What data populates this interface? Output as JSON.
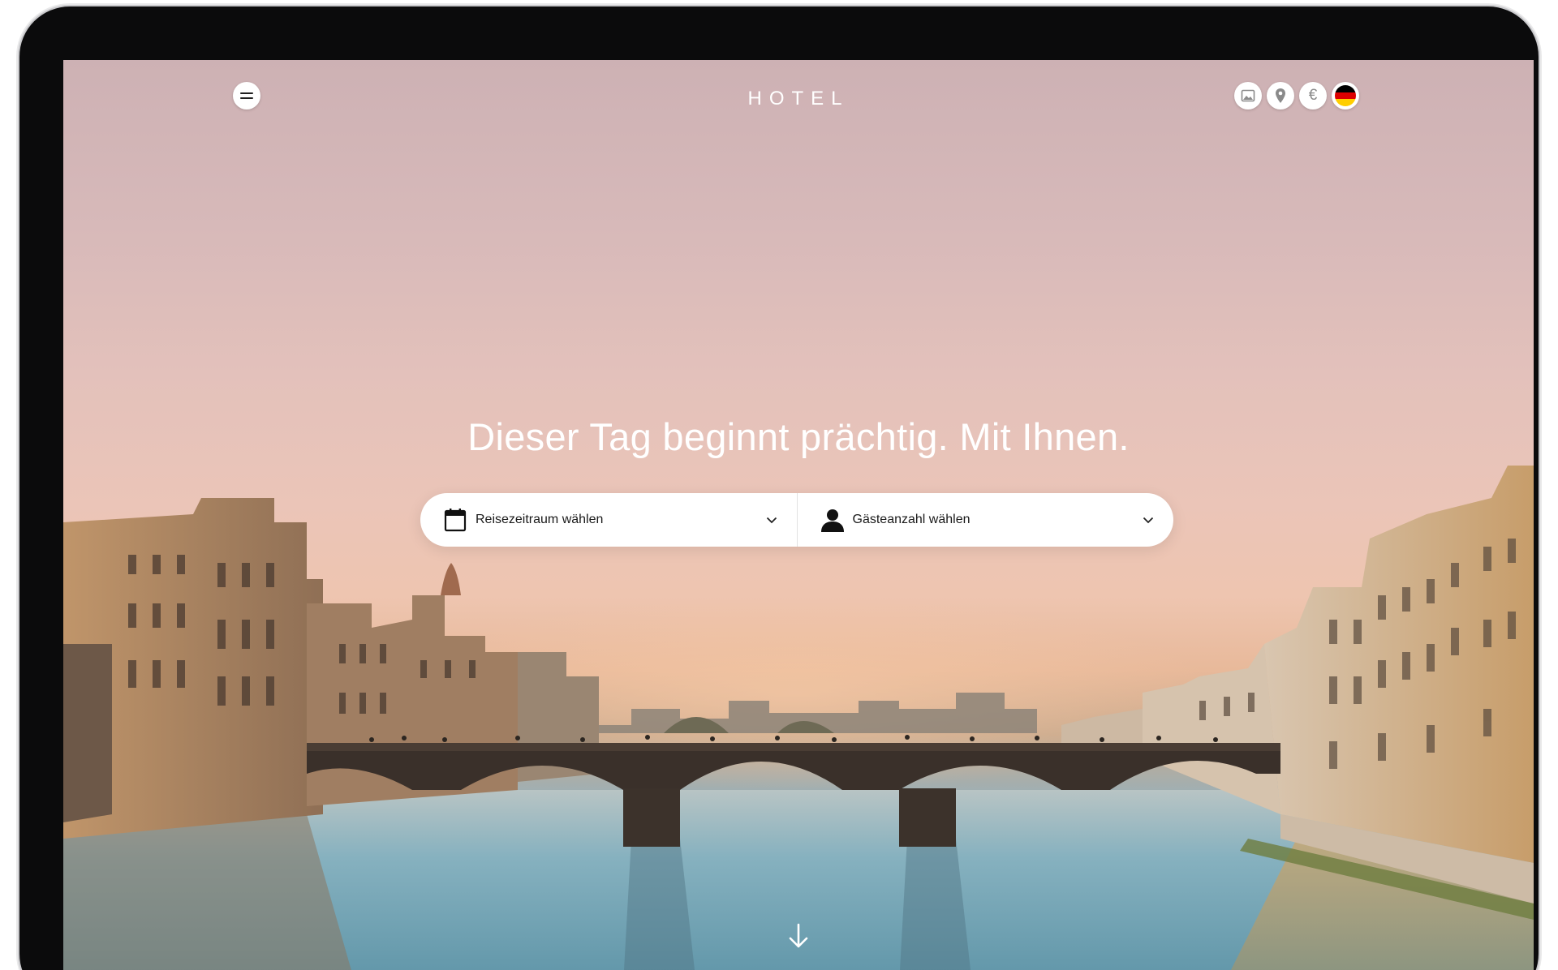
{
  "header": {
    "brand": "HOTEL",
    "menu_icon": "hamburger-menu-icon",
    "utility_icons": [
      "gallery-icon",
      "location-pin-icon",
      "euro-currency-icon",
      "german-flag-icon"
    ],
    "currency_symbol": "€"
  },
  "hero": {
    "headline": "Dieser Tag beginnt prächtig. Mit Ihnen."
  },
  "search": {
    "date_label": "Reisezeitraum wählen",
    "date_icon": "calendar-icon",
    "guests_label": "Gästeanzahl wählen",
    "guests_icon": "person-icon",
    "dropdown_icon": "chevron-down-icon"
  },
  "scroll_icon": "arrow-down-icon",
  "colors": {
    "background_sky": "#d7b9b9",
    "water": "#6fa2b3",
    "flag": [
      "#000000",
      "#dd0000",
      "#ffce00"
    ]
  }
}
